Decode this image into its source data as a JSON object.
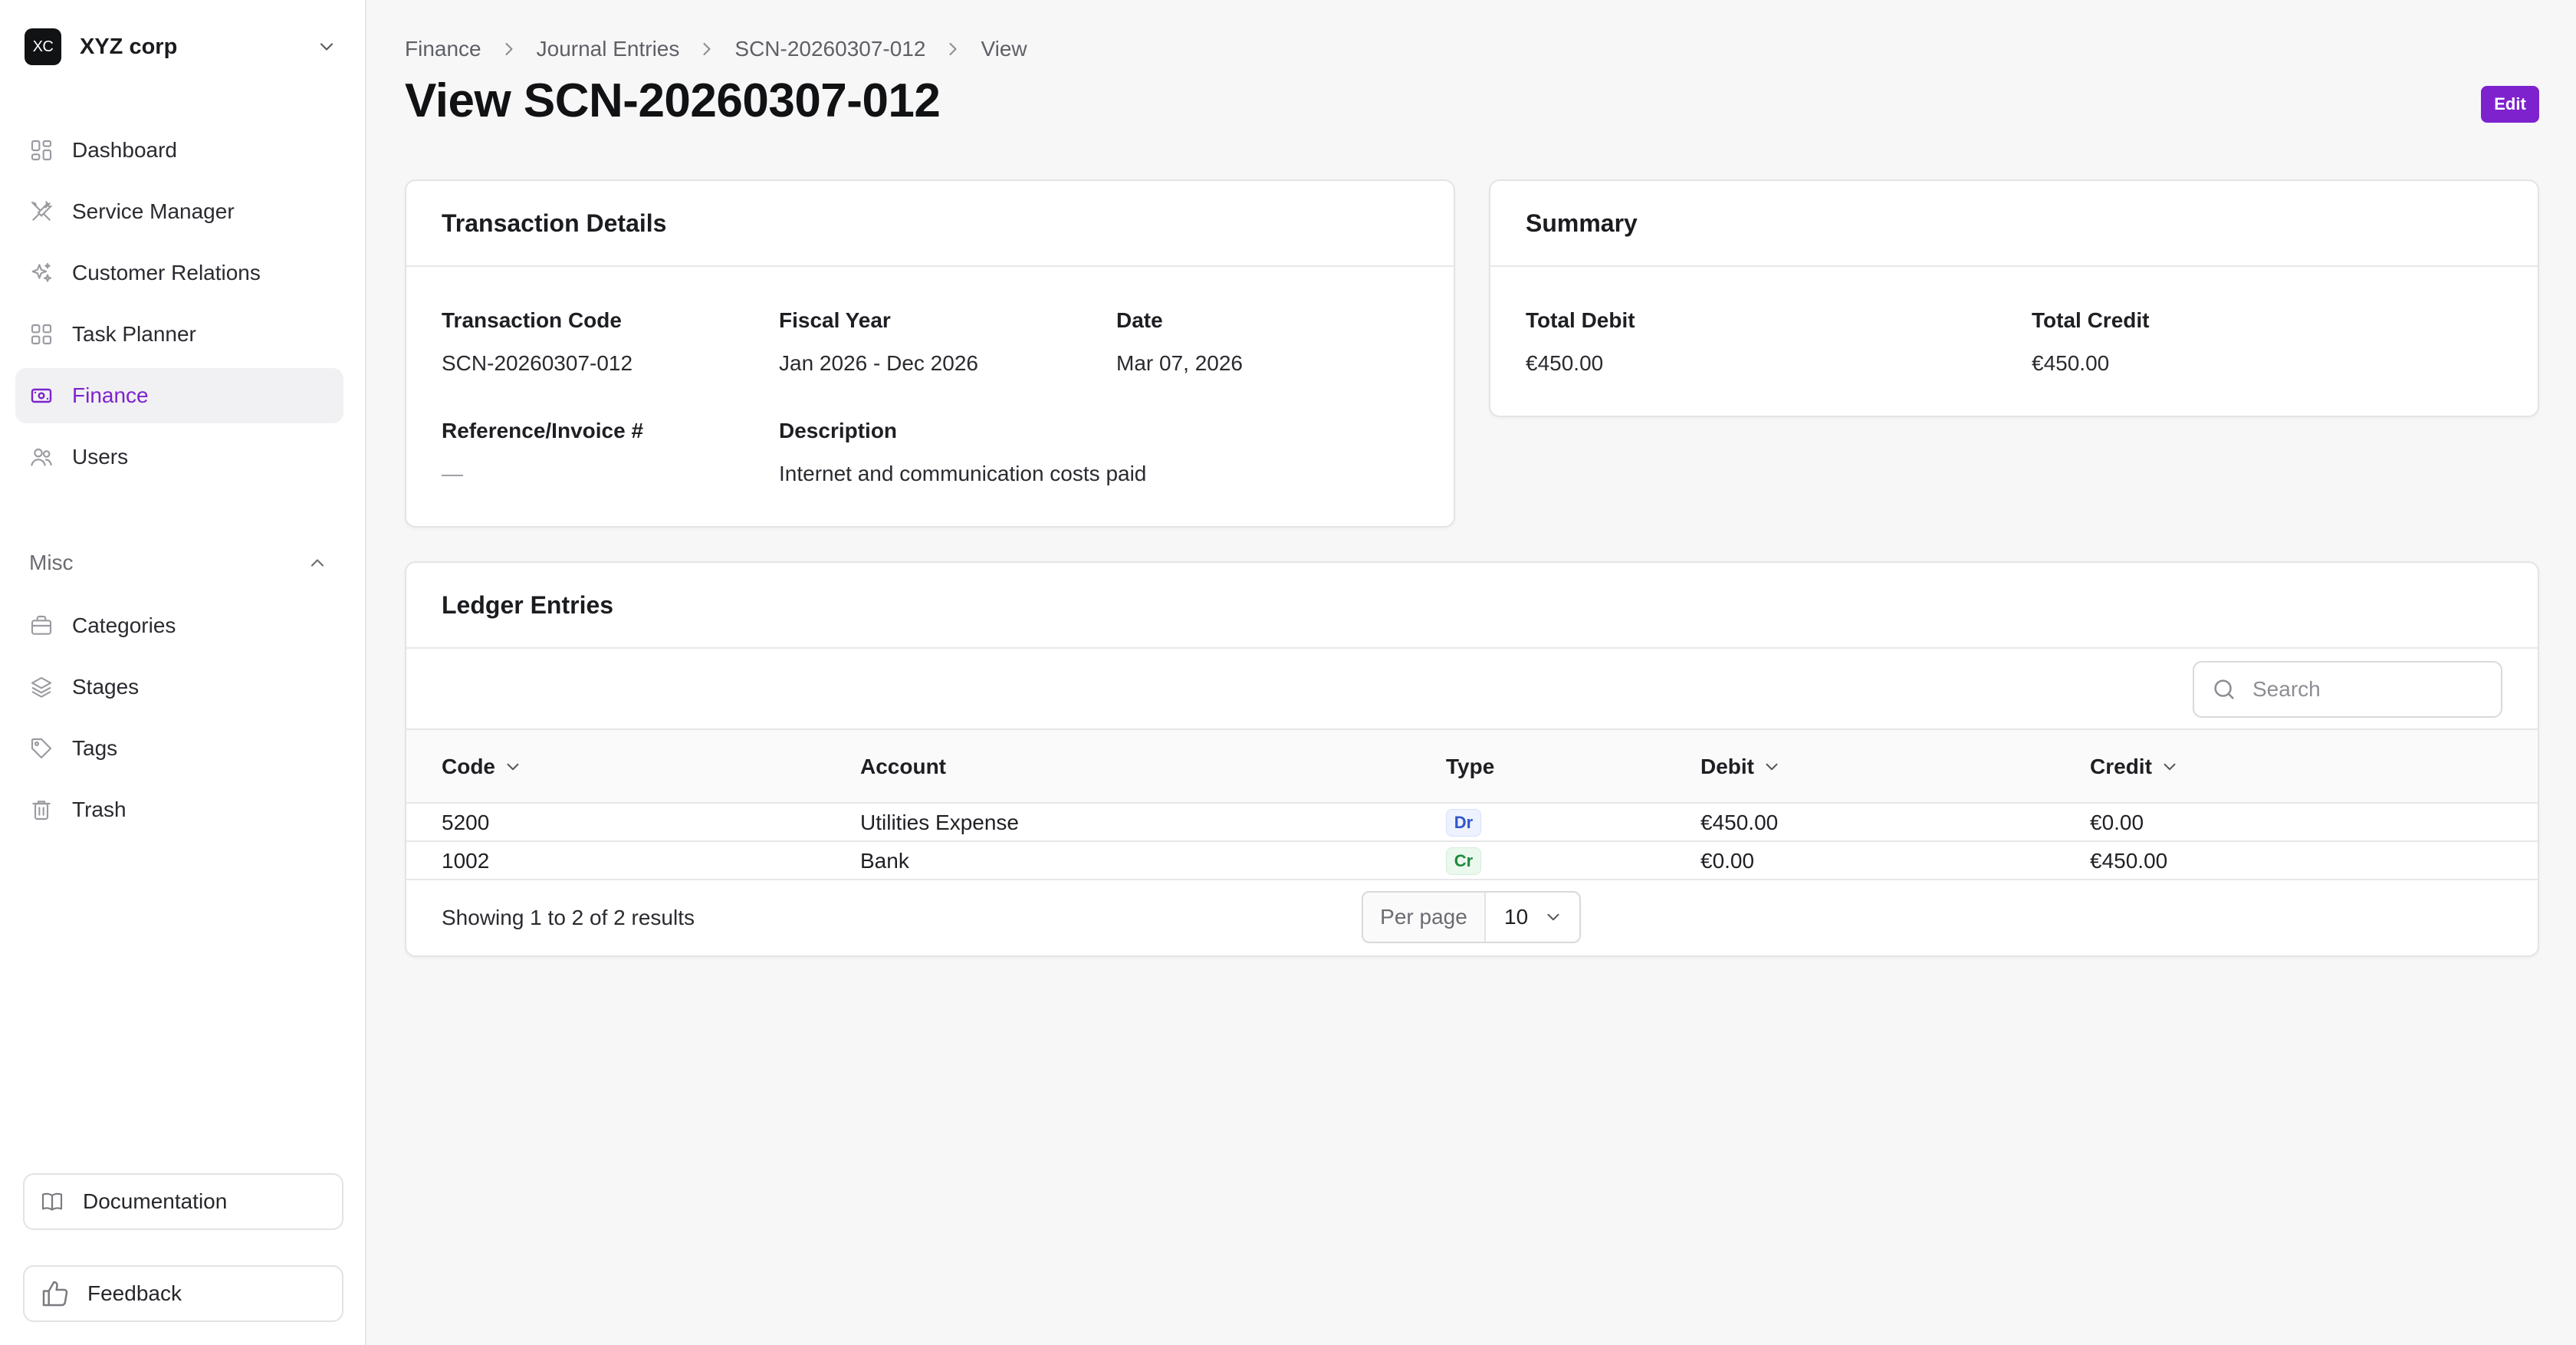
{
  "sidebar": {
    "brand": {
      "initials": "XC",
      "name": "XYZ corp"
    },
    "items": [
      {
        "label": "Dashboard",
        "icon": "dashboard-icon"
      },
      {
        "label": "Service Manager",
        "icon": "tools-icon"
      },
      {
        "label": "Customer Relations",
        "icon": "sparkles-icon"
      },
      {
        "label": "Task Planner",
        "icon": "grid-icon"
      },
      {
        "label": "Finance",
        "icon": "banknote-icon",
        "active": true
      },
      {
        "label": "Users",
        "icon": "users-icon"
      }
    ],
    "section_label": "Misc",
    "misc_items": [
      {
        "label": "Categories",
        "icon": "briefcase-icon"
      },
      {
        "label": "Stages",
        "icon": "layers-icon"
      },
      {
        "label": "Tags",
        "icon": "tag-icon"
      },
      {
        "label": "Trash",
        "icon": "trash-icon"
      }
    ],
    "documentation_label": "Documentation",
    "feedback_label": "Feedback"
  },
  "header": {
    "breadcrumb": [
      "Finance",
      "Journal Entries",
      "SCN-20260307-012",
      "View"
    ],
    "title": "View SCN-20260307-012",
    "edit_label": "Edit"
  },
  "transaction": {
    "heading": "Transaction Details",
    "code_label": "Transaction Code",
    "code": "SCN-20260307-012",
    "fiscal_label": "Fiscal Year",
    "fiscal": "Jan 2026 - Dec 2026",
    "date_label": "Date",
    "date": "Mar 07, 2026",
    "reference_label": "Reference/Invoice #",
    "reference": "—",
    "description_label": "Description",
    "description": "Internet and communication costs paid"
  },
  "summary": {
    "heading": "Summary",
    "debit_label": "Total Debit",
    "debit": "€450.00",
    "credit_label": "Total Credit",
    "credit": "€450.00"
  },
  "ledger": {
    "heading": "Ledger Entries",
    "search_placeholder": "Search",
    "columns": {
      "code": "Code",
      "account": "Account",
      "type": "Type",
      "debit": "Debit",
      "credit": "Credit"
    },
    "rows": [
      {
        "code": "5200",
        "account": "Utilities Expense",
        "type": "Dr",
        "debit": "€450.00",
        "credit": "€0.00"
      },
      {
        "code": "1002",
        "account": "Bank",
        "type": "Cr",
        "debit": "€0.00",
        "credit": "€450.00"
      }
    ],
    "showing": "Showing 1 to 2 of 2 results",
    "per_page_label": "Per page",
    "per_page_value": "10"
  },
  "colors": {
    "accent": "#7e22ce",
    "debit_badge": "#3057c9",
    "credit_badge": "#1d8a3d"
  }
}
